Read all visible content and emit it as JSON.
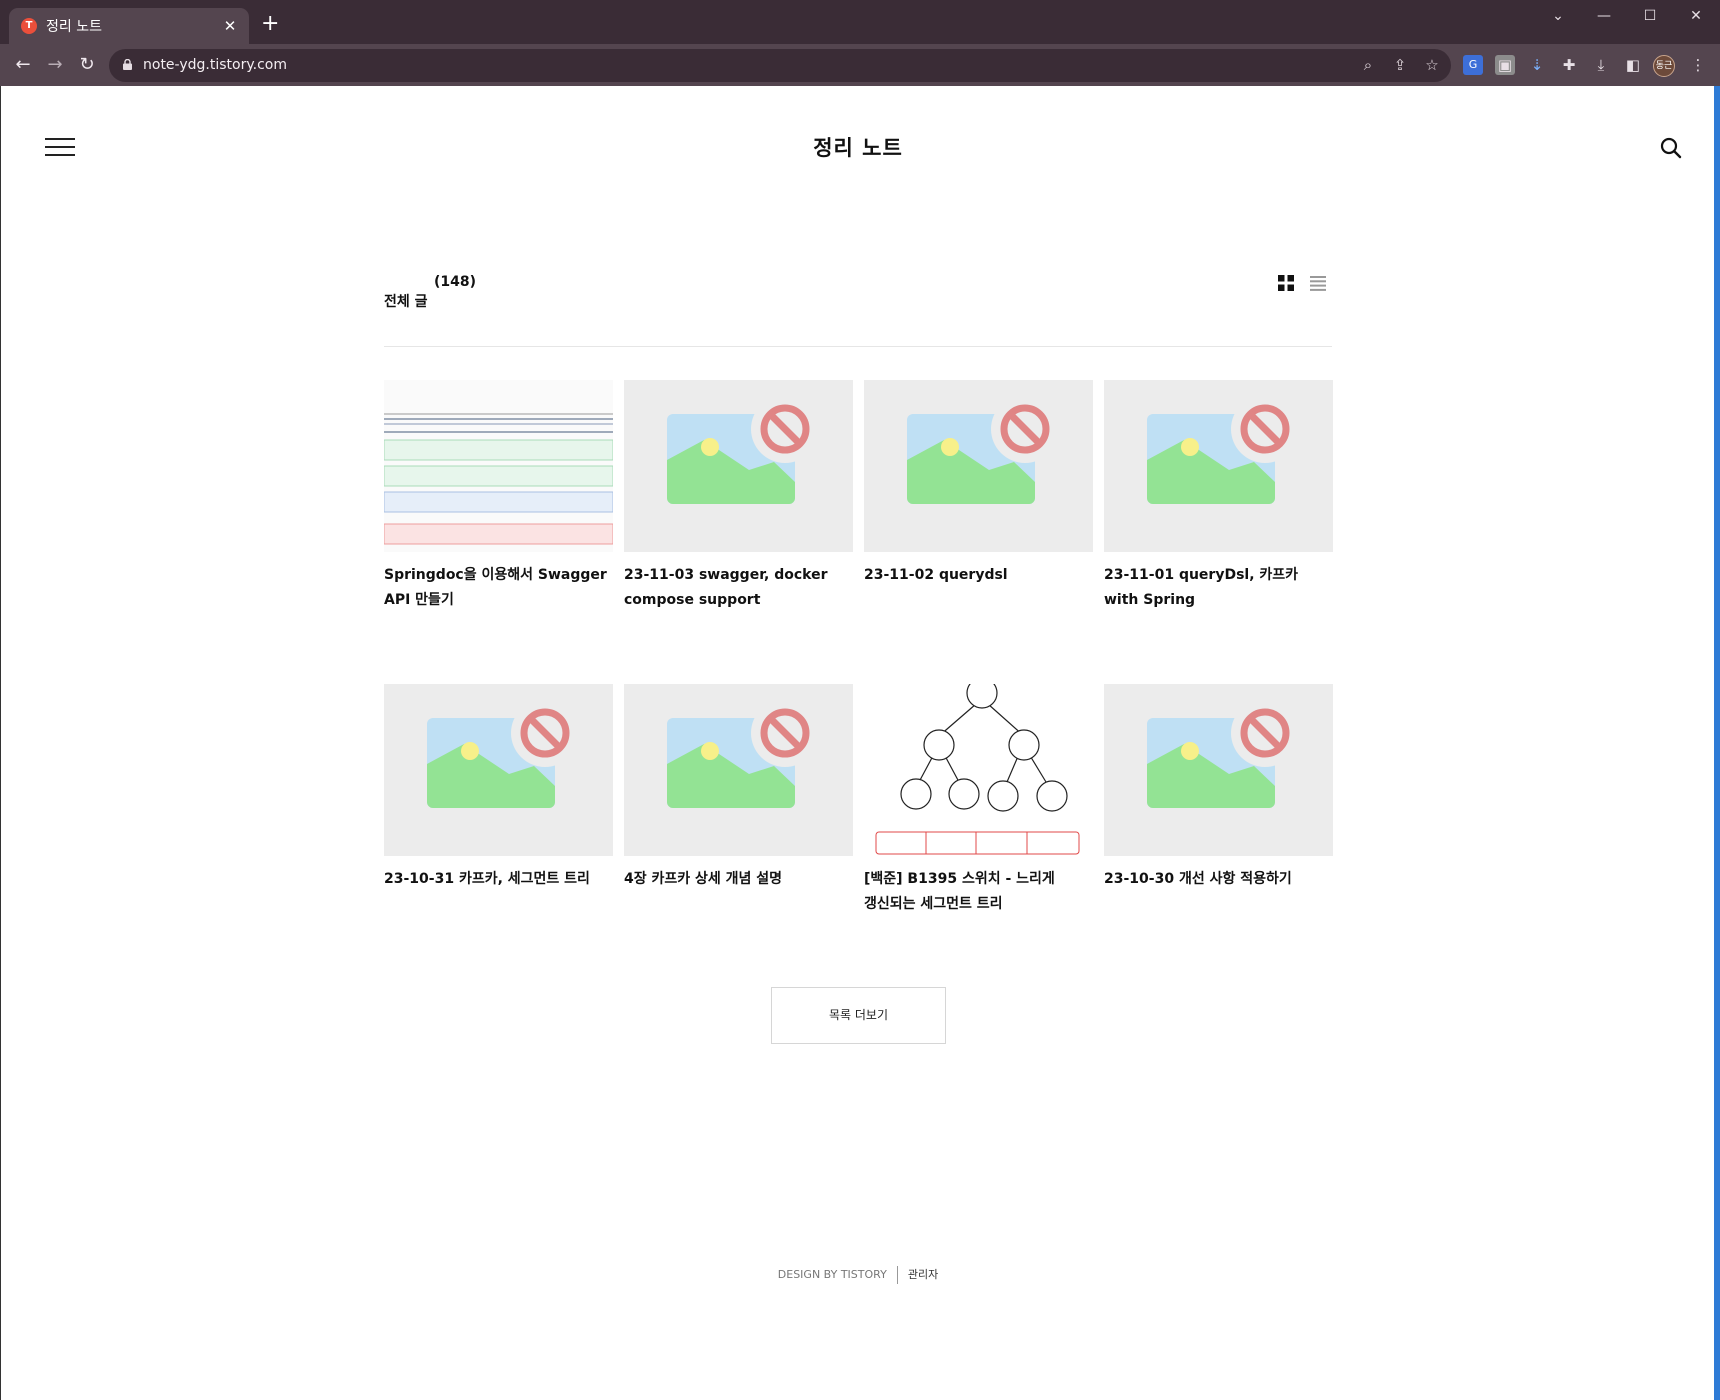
{
  "browser": {
    "tab_title": "정리 노트",
    "tab_favicon": "T",
    "url": "note-ydg.tistory.com",
    "profile_initials": "동근"
  },
  "header": {
    "blog_title": "정리 노트"
  },
  "category": {
    "name": "전체 글",
    "count": "(148)"
  },
  "posts": [
    {
      "title": "Springdoc을 이용해서 Swagger API 만들기",
      "thumbnail": "table-screenshot"
    },
    {
      "title": "23-11-03 swagger, docker compose support",
      "thumbnail": "broken-image"
    },
    {
      "title": "23-11-02 querydsl",
      "thumbnail": "broken-image"
    },
    {
      "title": "23-11-01 queryDsl, 카프카 with Spring",
      "thumbnail": "broken-image"
    },
    {
      "title": "23-10-31 카프카, 세그먼트 트리",
      "thumbnail": "broken-image"
    },
    {
      "title": "4장 카프카 상세 개념 설명",
      "thumbnail": "broken-image"
    },
    {
      "title": "[백준] B1395 스위치 - 느리게 갱신되는 세그먼트 트리",
      "thumbnail": "segment-tree-drawing"
    },
    {
      "title": "23-10-30 개선 사항 적용하기",
      "thumbnail": "broken-image"
    }
  ],
  "more_button": "목록 더보기",
  "footer": {
    "design": "DESIGN BY TISTORY",
    "admin": "관리자"
  },
  "colors": {
    "tabbar": "#3a2c36",
    "toolbar": "#54454f",
    "scrollbar": "#2e7bd6",
    "thumb_bg": "#ececec"
  }
}
